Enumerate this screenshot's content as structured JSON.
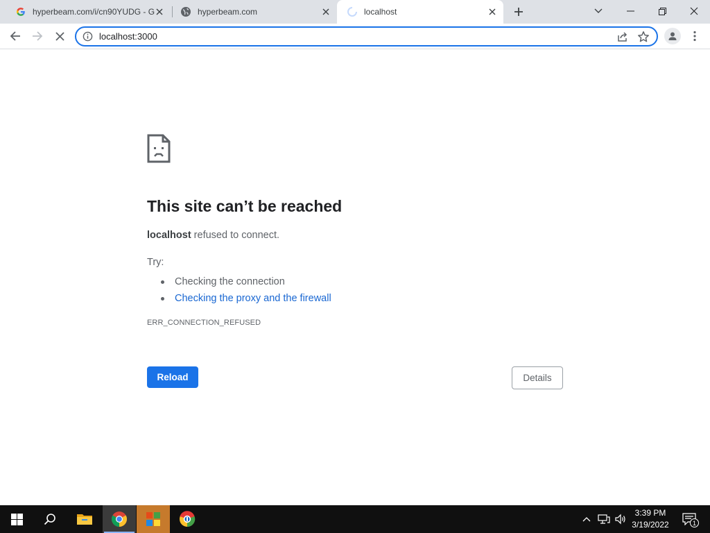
{
  "browser": {
    "tabs": [
      {
        "title": "hyperbeam.com/i/cn90YUDG - G",
        "favicon": "google-g-icon"
      },
      {
        "title": "hyperbeam.com",
        "favicon": "globe-icon"
      },
      {
        "title": "localhost",
        "favicon": "loading-spinner-icon",
        "active": true
      }
    ],
    "address": "localhost:3000"
  },
  "error_page": {
    "title": "This site can’t be reached",
    "host": "localhost",
    "message": " refused to connect.",
    "try_label": "Try:",
    "suggestions": [
      {
        "text": "Checking the connection",
        "link": false
      },
      {
        "text": "Checking the proxy and the firewall",
        "link": true
      }
    ],
    "error_code": "ERR_CONNECTION_REFUSED",
    "reload_label": "Reload",
    "details_label": "Details"
  },
  "taskbar": {
    "time": "3:39 PM",
    "date": "3/19/2022",
    "notification_count": "1",
    "items": [
      "start-icon",
      "search-icon",
      "file-explorer-icon",
      "chrome-icon",
      "app-icon",
      "browser-app-icon"
    ]
  },
  "colors": {
    "accent": "#1a73e8",
    "link": "#1967d2",
    "tabstrip": "#dee1e6",
    "taskbar": "#101010"
  }
}
